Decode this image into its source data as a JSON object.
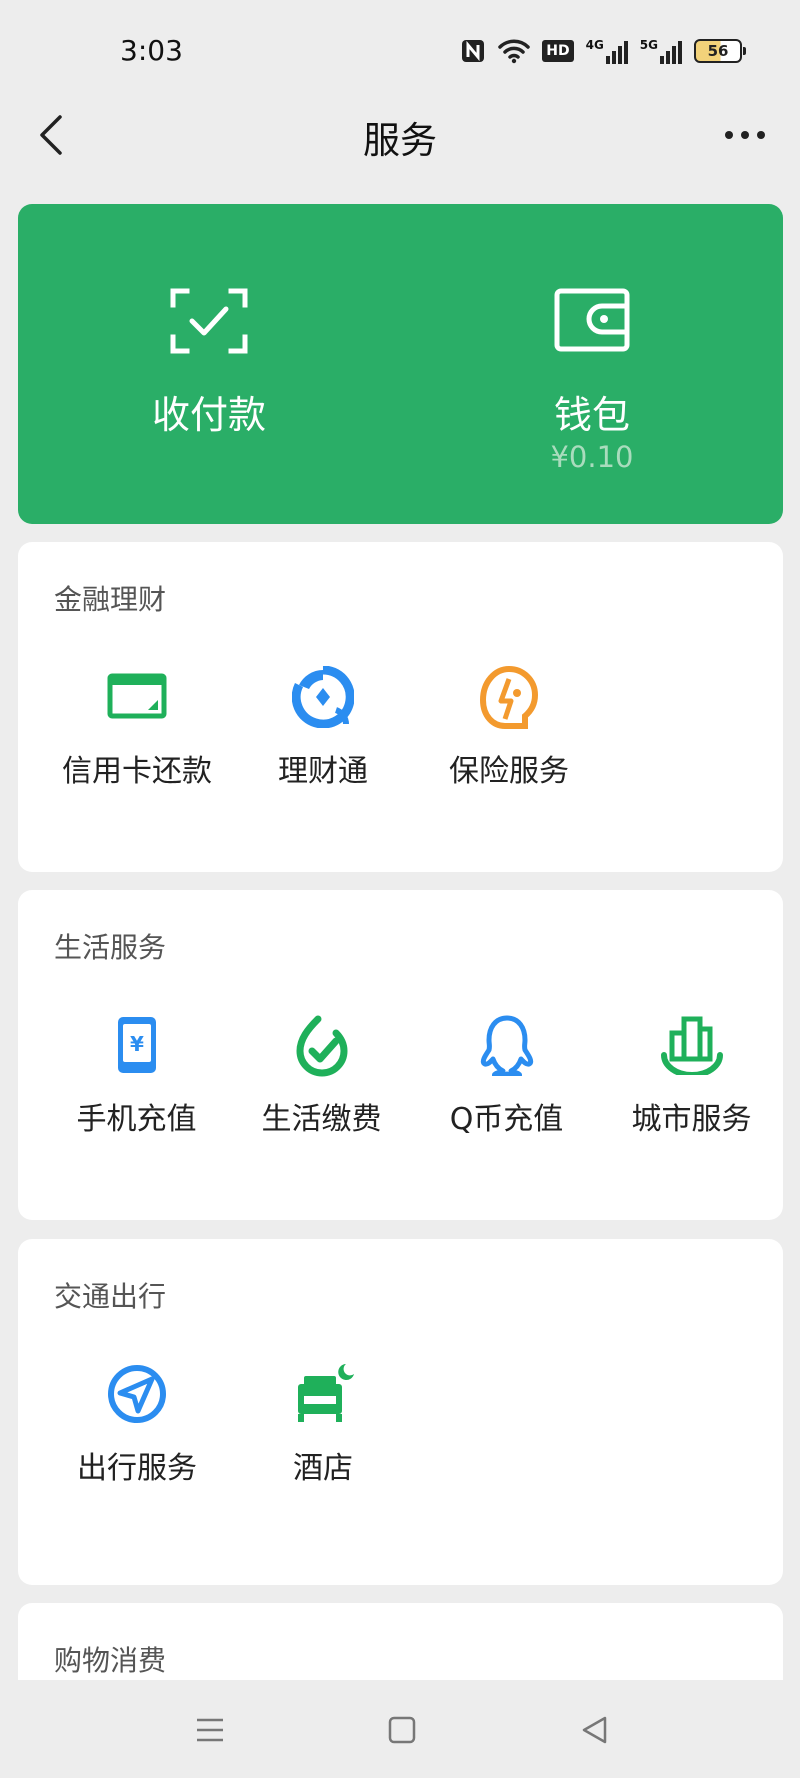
{
  "status_bar": {
    "time": "3:03",
    "battery": "56",
    "net_4g": "4G",
    "net_5g": "5G",
    "hd": "HD"
  },
  "header": {
    "title": "服务"
  },
  "hero": {
    "pay": {
      "label": "收付款",
      "icon": "scan-check-icon"
    },
    "wallet": {
      "label": "钱包",
      "balance": "¥0.10",
      "icon": "wallet-icon"
    }
  },
  "sections": {
    "finance": {
      "title": "金融理财",
      "items": [
        {
          "label": "信用卡还款",
          "icon": "credit-card-icon"
        },
        {
          "label": "理财通",
          "icon": "wealth-icon"
        },
        {
          "label": "保险服务",
          "icon": "insurance-icon"
        }
      ]
    },
    "life": {
      "title": "生活服务",
      "items": [
        {
          "label": "手机充值",
          "icon": "phone-topup-icon"
        },
        {
          "label": "生活缴费",
          "icon": "utility-bill-icon"
        },
        {
          "label": "Q币充值",
          "icon": "qq-coin-icon"
        },
        {
          "label": "城市服务",
          "icon": "city-service-icon"
        }
      ]
    },
    "travel": {
      "title": "交通出行",
      "items": [
        {
          "label": "出行服务",
          "icon": "travel-icon"
        },
        {
          "label": "酒店",
          "icon": "hotel-icon"
        }
      ]
    },
    "shopping": {
      "title": "购物消费"
    }
  },
  "colors": {
    "hero_bg": "#2aae67",
    "green": "#1fb05a",
    "blue": "#2b8df0",
    "orange": "#f39a2e",
    "page_bg": "#ededed"
  }
}
